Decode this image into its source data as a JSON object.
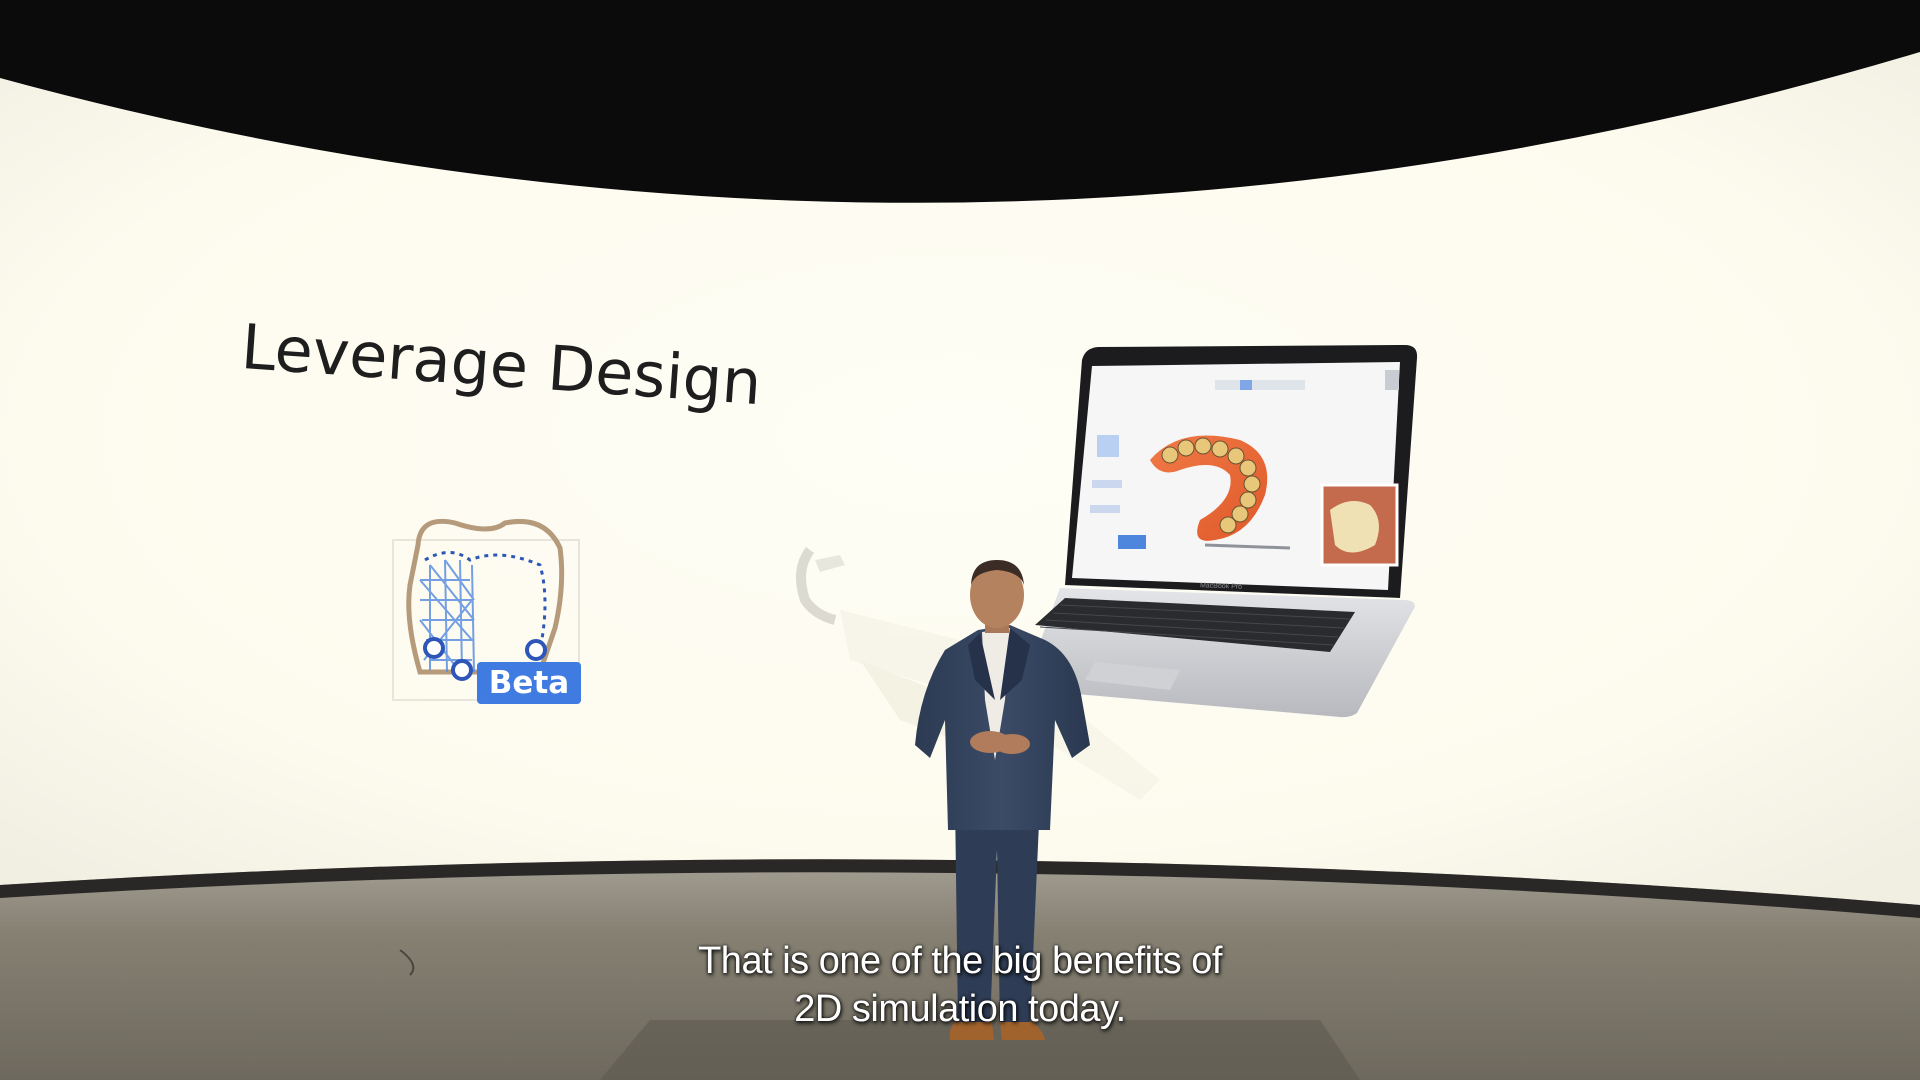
{
  "slide": {
    "title": "Leverage Design",
    "badge_label": "Beta",
    "icon": "tooth-design-icon"
  },
  "laptop": {
    "brand_label": "MacBook Pro"
  },
  "subtitles": {
    "line1": "That is one of the big benefits of",
    "line2": "2D simulation today."
  },
  "colors": {
    "screen_bg": "#fffdf2",
    "badge": "#3f7be0",
    "dark_surround": "#0b0b0c",
    "floor": "#7c776c"
  }
}
